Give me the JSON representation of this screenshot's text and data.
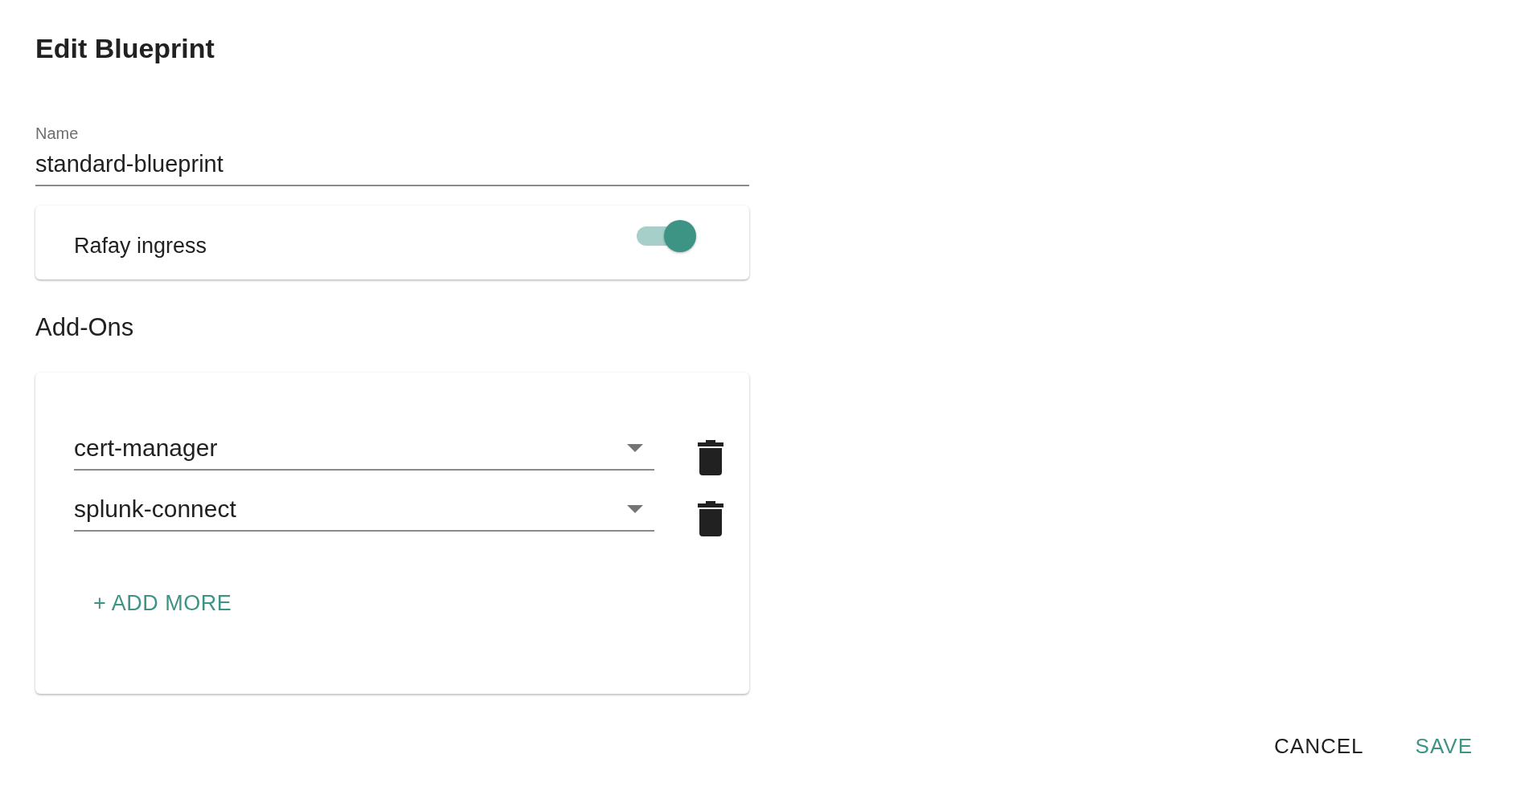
{
  "dialog": {
    "title": "Edit Blueprint"
  },
  "name_field": {
    "label": "Name",
    "value": "standard-blueprint"
  },
  "ingress": {
    "label": "Rafay ingress",
    "on": true
  },
  "addons": {
    "heading": "Add-Ons",
    "items": [
      {
        "value": "cert-manager"
      },
      {
        "value": "splunk-connect"
      }
    ],
    "add_button": "+ ADD MORE"
  },
  "buttons": [
    {
      "label": "CANCEL",
      "kind": "plain"
    },
    {
      "label": "SAVE",
      "kind": "primary"
    }
  ]
}
